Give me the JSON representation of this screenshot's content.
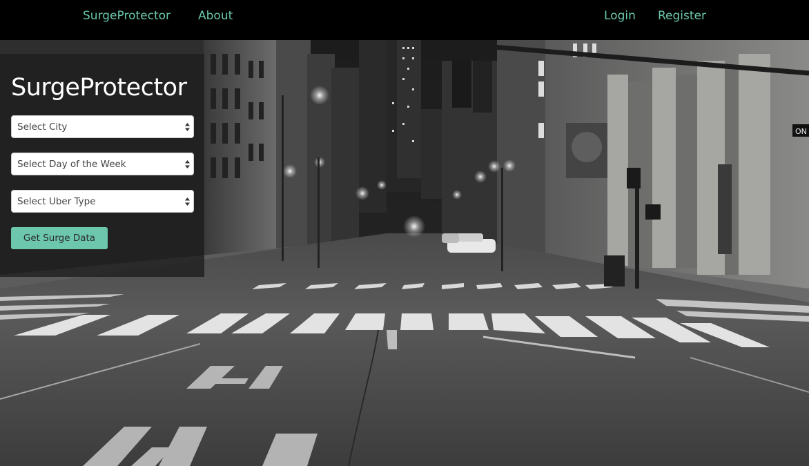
{
  "navbar": {
    "brand": "SurgeProtector",
    "about": "About",
    "login": "Login",
    "register": "Register",
    "link_color": "#6cc7ad",
    "background": "#000000"
  },
  "hero": {
    "description_icon": "street-photo",
    "street_sign_text": "ON"
  },
  "form": {
    "title": "SurgeProtector",
    "city_select": {
      "selected": "Select City"
    },
    "day_select": {
      "selected": "Select Day of the Week"
    },
    "type_select": {
      "selected": "Select Uber Type"
    },
    "submit_label": "Get Surge Data",
    "button_color": "#6cc7ad"
  }
}
